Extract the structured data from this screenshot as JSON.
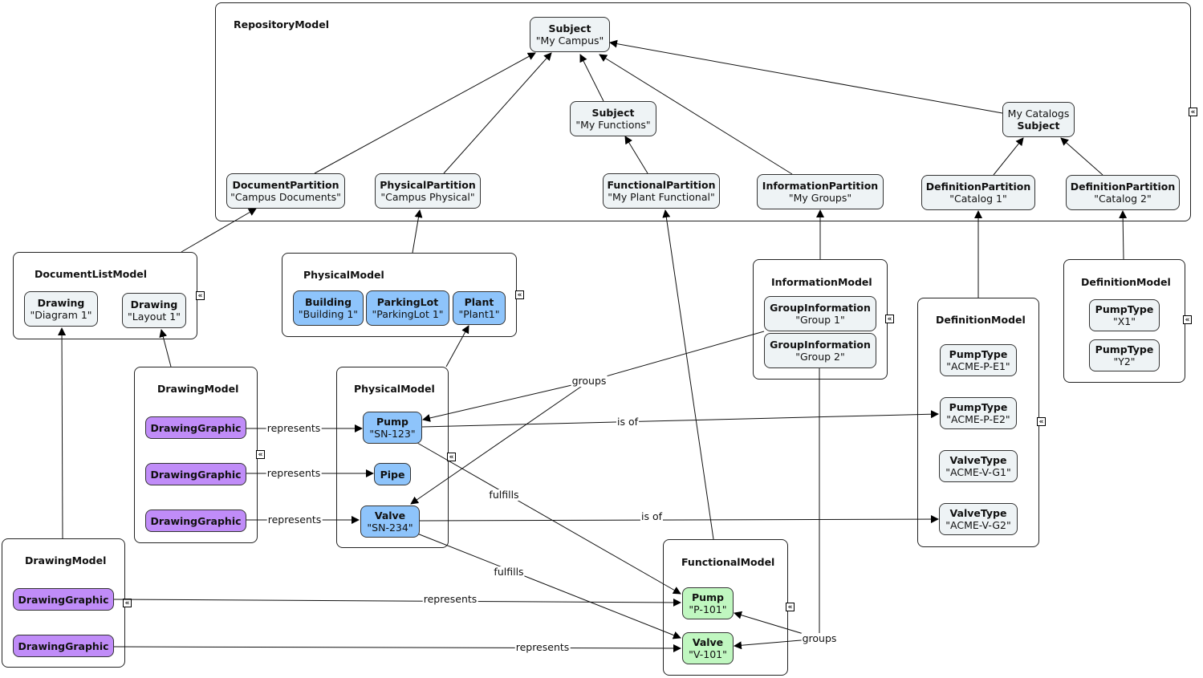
{
  "containers": {
    "repository": {
      "title": "RepositoryModel"
    },
    "documentList": {
      "title": "DocumentListModel"
    },
    "physicalTop": {
      "title": "PhysicalModel"
    },
    "drawing1": {
      "title": "DrawingModel"
    },
    "physical2": {
      "title": "PhysicalModel"
    },
    "information": {
      "title": "InformationModel"
    },
    "definition1": {
      "title": "DefinitionModel"
    },
    "definition2": {
      "title": "DefinitionModel"
    },
    "drawing2": {
      "title": "DrawingModel"
    },
    "functional": {
      "title": "FunctionalModel"
    }
  },
  "nodes": {
    "subjectCampus": {
      "type": "Subject",
      "value": "\"My Campus\""
    },
    "subjectFunctions": {
      "type": "Subject",
      "value": "\"My Functions\""
    },
    "subjectCatalogs": {
      "type": "Subject",
      "value": "My Catalogs"
    },
    "docPartition": {
      "type": "DocumentPartition",
      "value": "\"Campus Documents\""
    },
    "physPartition": {
      "type": "PhysicalPartition",
      "value": "\"Campus Physical\""
    },
    "funcPartition": {
      "type": "FunctionalPartition",
      "value": "\"My Plant Functional\""
    },
    "infoPartition": {
      "type": "InformationPartition",
      "value": "\"My Groups\""
    },
    "defPartition1": {
      "type": "DefinitionPartition",
      "value": "\"Catalog 1\""
    },
    "defPartition2": {
      "type": "DefinitionPartition",
      "value": "\"Catalog 2\""
    },
    "drawingDiagram": {
      "type": "Drawing",
      "value": "\"Diagram 1\""
    },
    "drawingLayout": {
      "type": "Drawing",
      "value": "\"Layout 1\""
    },
    "building": {
      "type": "Building",
      "value": "\"Building 1\""
    },
    "parkingLot": {
      "type": "ParkingLot",
      "value": "\"ParkingLot 1\""
    },
    "plant": {
      "type": "Plant",
      "value": "\"Plant1\""
    },
    "group1": {
      "type": "GroupInformation",
      "value": "\"Group 1\""
    },
    "group2": {
      "type": "GroupInformation",
      "value": "\"Group 2\""
    },
    "pumpTypeX1": {
      "type": "PumpType",
      "value": "\"X1\""
    },
    "pumpTypeY2": {
      "type": "PumpType",
      "value": "\"Y2\""
    },
    "pumpTypeE1": {
      "type": "PumpType",
      "value": "\"ACME-P-E1\""
    },
    "pumpTypeE2": {
      "type": "PumpType",
      "value": "\"ACME-P-E2\""
    },
    "valveTypeG1": {
      "type": "ValveType",
      "value": "\"ACME-V-G1\""
    },
    "valveTypeG2": {
      "type": "ValveType",
      "value": "\"ACME-V-G2\""
    },
    "dg1": {
      "type": "DrawingGraphic"
    },
    "dg2": {
      "type": "DrawingGraphic"
    },
    "dg3": {
      "type": "DrawingGraphic"
    },
    "dg4": {
      "type": "DrawingGraphic"
    },
    "dg5": {
      "type": "DrawingGraphic"
    },
    "pumpSN123": {
      "type": "Pump",
      "value": "\"SN-123\""
    },
    "pipe": {
      "type": "Pipe"
    },
    "valveSN234": {
      "type": "Valve",
      "value": "\"SN-234\""
    },
    "pumpP101": {
      "type": "Pump",
      "value": "\"P-101\""
    },
    "valveV101": {
      "type": "Valve",
      "value": "\"V-101\""
    }
  },
  "edgeLabels": {
    "represents": "represents",
    "isOf": "is of",
    "fulfills": "fulfills",
    "groups": "groups"
  },
  "icons": {
    "collapse": "«"
  },
  "colors": {
    "gray": "#eef3f5",
    "blue": "#8ec4fb",
    "purple": "#c08cf8",
    "green": "#c0f7c0"
  }
}
